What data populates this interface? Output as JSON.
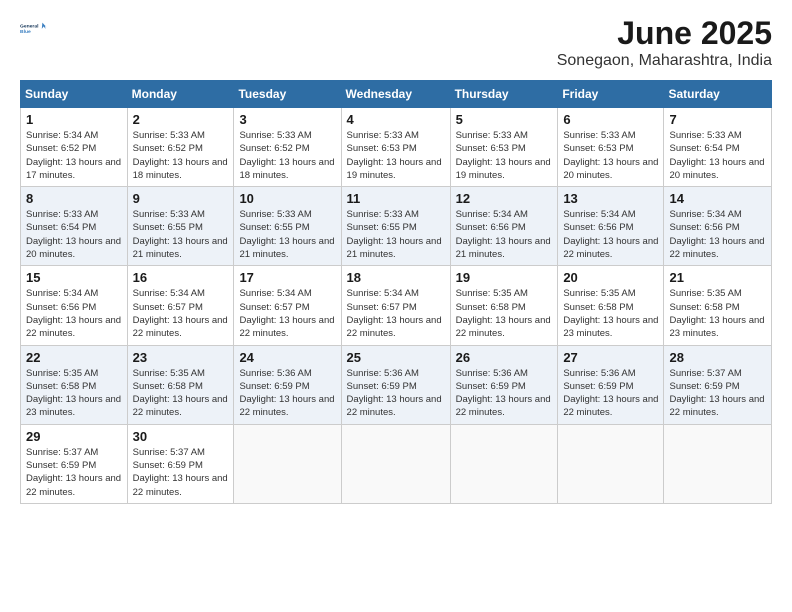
{
  "logo": {
    "line1": "General",
    "line2": "Blue"
  },
  "title": "June 2025",
  "subtitle": "Sonegaon, Maharashtra, India",
  "headers": [
    "Sunday",
    "Monday",
    "Tuesday",
    "Wednesday",
    "Thursday",
    "Friday",
    "Saturday"
  ],
  "rows": [
    [
      {
        "day": "1",
        "sunrise": "Sunrise: 5:34 AM",
        "sunset": "Sunset: 6:52 PM",
        "daylight": "Daylight: 13 hours and 17 minutes."
      },
      {
        "day": "2",
        "sunrise": "Sunrise: 5:33 AM",
        "sunset": "Sunset: 6:52 PM",
        "daylight": "Daylight: 13 hours and 18 minutes."
      },
      {
        "day": "3",
        "sunrise": "Sunrise: 5:33 AM",
        "sunset": "Sunset: 6:52 PM",
        "daylight": "Daylight: 13 hours and 18 minutes."
      },
      {
        "day": "4",
        "sunrise": "Sunrise: 5:33 AM",
        "sunset": "Sunset: 6:53 PM",
        "daylight": "Daylight: 13 hours and 19 minutes."
      },
      {
        "day": "5",
        "sunrise": "Sunrise: 5:33 AM",
        "sunset": "Sunset: 6:53 PM",
        "daylight": "Daylight: 13 hours and 19 minutes."
      },
      {
        "day": "6",
        "sunrise": "Sunrise: 5:33 AM",
        "sunset": "Sunset: 6:53 PM",
        "daylight": "Daylight: 13 hours and 20 minutes."
      },
      {
        "day": "7",
        "sunrise": "Sunrise: 5:33 AM",
        "sunset": "Sunset: 6:54 PM",
        "daylight": "Daylight: 13 hours and 20 minutes."
      }
    ],
    [
      {
        "day": "8",
        "sunrise": "Sunrise: 5:33 AM",
        "sunset": "Sunset: 6:54 PM",
        "daylight": "Daylight: 13 hours and 20 minutes."
      },
      {
        "day": "9",
        "sunrise": "Sunrise: 5:33 AM",
        "sunset": "Sunset: 6:55 PM",
        "daylight": "Daylight: 13 hours and 21 minutes."
      },
      {
        "day": "10",
        "sunrise": "Sunrise: 5:33 AM",
        "sunset": "Sunset: 6:55 PM",
        "daylight": "Daylight: 13 hours and 21 minutes."
      },
      {
        "day": "11",
        "sunrise": "Sunrise: 5:33 AM",
        "sunset": "Sunset: 6:55 PM",
        "daylight": "Daylight: 13 hours and 21 minutes."
      },
      {
        "day": "12",
        "sunrise": "Sunrise: 5:34 AM",
        "sunset": "Sunset: 6:56 PM",
        "daylight": "Daylight: 13 hours and 21 minutes."
      },
      {
        "day": "13",
        "sunrise": "Sunrise: 5:34 AM",
        "sunset": "Sunset: 6:56 PM",
        "daylight": "Daylight: 13 hours and 22 minutes."
      },
      {
        "day": "14",
        "sunrise": "Sunrise: 5:34 AM",
        "sunset": "Sunset: 6:56 PM",
        "daylight": "Daylight: 13 hours and 22 minutes."
      }
    ],
    [
      {
        "day": "15",
        "sunrise": "Sunrise: 5:34 AM",
        "sunset": "Sunset: 6:56 PM",
        "daylight": "Daylight: 13 hours and 22 minutes."
      },
      {
        "day": "16",
        "sunrise": "Sunrise: 5:34 AM",
        "sunset": "Sunset: 6:57 PM",
        "daylight": "Daylight: 13 hours and 22 minutes."
      },
      {
        "day": "17",
        "sunrise": "Sunrise: 5:34 AM",
        "sunset": "Sunset: 6:57 PM",
        "daylight": "Daylight: 13 hours and 22 minutes."
      },
      {
        "day": "18",
        "sunrise": "Sunrise: 5:34 AM",
        "sunset": "Sunset: 6:57 PM",
        "daylight": "Daylight: 13 hours and 22 minutes."
      },
      {
        "day": "19",
        "sunrise": "Sunrise: 5:35 AM",
        "sunset": "Sunset: 6:58 PM",
        "daylight": "Daylight: 13 hours and 22 minutes."
      },
      {
        "day": "20",
        "sunrise": "Sunrise: 5:35 AM",
        "sunset": "Sunset: 6:58 PM",
        "daylight": "Daylight: 13 hours and 23 minutes."
      },
      {
        "day": "21",
        "sunrise": "Sunrise: 5:35 AM",
        "sunset": "Sunset: 6:58 PM",
        "daylight": "Daylight: 13 hours and 23 minutes."
      }
    ],
    [
      {
        "day": "22",
        "sunrise": "Sunrise: 5:35 AM",
        "sunset": "Sunset: 6:58 PM",
        "daylight": "Daylight: 13 hours and 23 minutes."
      },
      {
        "day": "23",
        "sunrise": "Sunrise: 5:35 AM",
        "sunset": "Sunset: 6:58 PM",
        "daylight": "Daylight: 13 hours and 22 minutes."
      },
      {
        "day": "24",
        "sunrise": "Sunrise: 5:36 AM",
        "sunset": "Sunset: 6:59 PM",
        "daylight": "Daylight: 13 hours and 22 minutes."
      },
      {
        "day": "25",
        "sunrise": "Sunrise: 5:36 AM",
        "sunset": "Sunset: 6:59 PM",
        "daylight": "Daylight: 13 hours and 22 minutes."
      },
      {
        "day": "26",
        "sunrise": "Sunrise: 5:36 AM",
        "sunset": "Sunset: 6:59 PM",
        "daylight": "Daylight: 13 hours and 22 minutes."
      },
      {
        "day": "27",
        "sunrise": "Sunrise: 5:36 AM",
        "sunset": "Sunset: 6:59 PM",
        "daylight": "Daylight: 13 hours and 22 minutes."
      },
      {
        "day": "28",
        "sunrise": "Sunrise: 5:37 AM",
        "sunset": "Sunset: 6:59 PM",
        "daylight": "Daylight: 13 hours and 22 minutes."
      }
    ],
    [
      {
        "day": "29",
        "sunrise": "Sunrise: 5:37 AM",
        "sunset": "Sunset: 6:59 PM",
        "daylight": "Daylight: 13 hours and 22 minutes."
      },
      {
        "day": "30",
        "sunrise": "Sunrise: 5:37 AM",
        "sunset": "Sunset: 6:59 PM",
        "daylight": "Daylight: 13 hours and 22 minutes."
      },
      {
        "day": "",
        "sunrise": "",
        "sunset": "",
        "daylight": ""
      },
      {
        "day": "",
        "sunrise": "",
        "sunset": "",
        "daylight": ""
      },
      {
        "day": "",
        "sunrise": "",
        "sunset": "",
        "daylight": ""
      },
      {
        "day": "",
        "sunrise": "",
        "sunset": "",
        "daylight": ""
      },
      {
        "day": "",
        "sunrise": "",
        "sunset": "",
        "daylight": ""
      }
    ]
  ]
}
